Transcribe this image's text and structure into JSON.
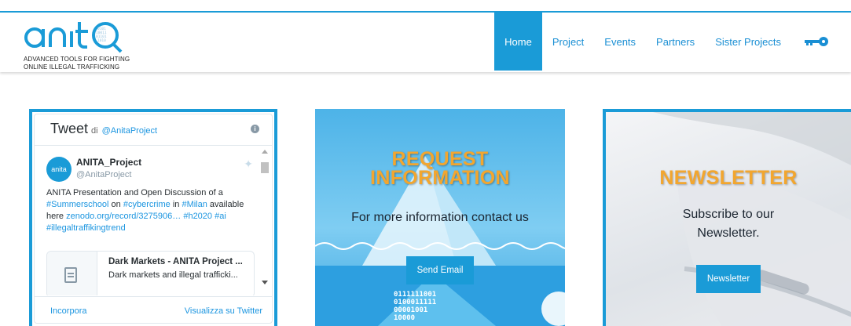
{
  "header": {
    "logo_text": "anitq",
    "tagline_line1": "ADVANCED TOOLS FOR FIGHTING",
    "tagline_line2": "ONLINE ILLEGAL TRAFFICKING",
    "nav": [
      {
        "label": "Home",
        "active": true
      },
      {
        "label": "Project"
      },
      {
        "label": "Events"
      },
      {
        "label": "Partners"
      },
      {
        "label": "Sister Projects"
      }
    ],
    "key_icon": "key-icon",
    "accent": "#1a9bd7"
  },
  "twitter": {
    "title": "Tweet",
    "di": "di",
    "handle_header": "@AnitaProject",
    "tweet": {
      "name": "ANITA_Project",
      "handle": "@AnitaProject",
      "text_1": "ANITA Presentation and Open Discussion of a",
      "link_summerschool": "#Summerschool",
      "text_on": "on",
      "link_cybercrime": "#cybercrime",
      "text_in": "in",
      "link_milan": "#Milan",
      "text_available": "available",
      "text_here": "here",
      "link_zenodo": "zenodo.org/record/3275906…",
      "link_h2020": "#h2020",
      "link_ai": "#ai",
      "link_trend": "#illegaltraffikingtrend",
      "card_title": "Dark Markets - ANITA Project ...",
      "card_desc": "Dark markets and illegal trafficki..."
    },
    "embed_label": "Incorpora",
    "view_label": "Visualizza su Twitter"
  },
  "request": {
    "title_line1": "REQUEST",
    "title_line2": "INFORMATION",
    "subtitle": "For more information contact us",
    "button": "Send Email",
    "binary": [
      "0111111001",
      "0100011111",
      "00001001",
      "10000"
    ]
  },
  "newsletter": {
    "title": "NEWSLETTER",
    "subtitle": "Subscribe to our Newsletter.",
    "button": "Newsletter"
  }
}
